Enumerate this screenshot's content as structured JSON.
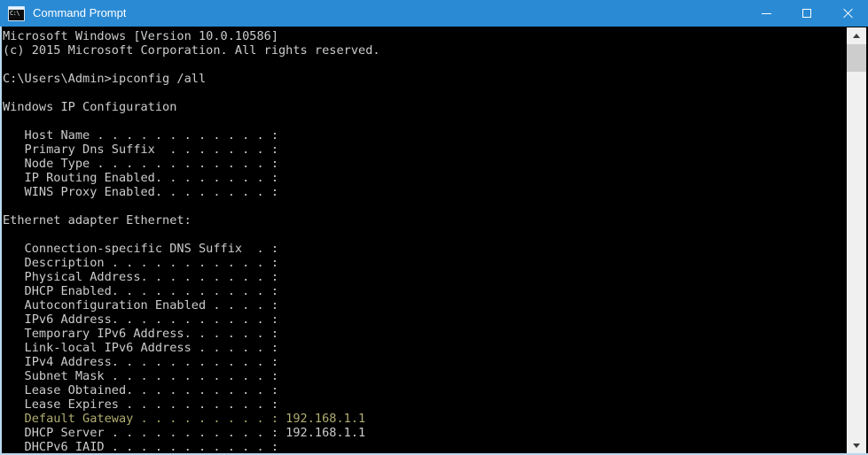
{
  "window": {
    "title": "Command Prompt",
    "icon": "command-prompt-icon",
    "icon_text": "C:\\",
    "titlebar_color": "#2a8ad4",
    "background_color": "#000000",
    "text_color": "#cccccc",
    "highlight_text_color": "#b0ad70"
  },
  "controls": {
    "minimize_label": "Minimize",
    "maximize_label": "Maximize",
    "close_label": "Close"
  },
  "scrollbar": {
    "up_arrow": "scroll-up-arrow",
    "down_arrow": "scroll-down-arrow",
    "thumb": "scrollbar-thumb"
  },
  "console": {
    "prompt_path": "C:\\Users\\Admin>",
    "command": "ipconfig /all",
    "lines": [
      {
        "text": "Microsoft Windows [Version 10.0.10586]",
        "color": "white"
      },
      {
        "text": "(c) 2015 Microsoft Corporation. All rights reserved.",
        "color": "white"
      },
      {
        "text": "",
        "color": "white"
      },
      {
        "text": "C:\\Users\\Admin>ipconfig /all",
        "color": "white"
      },
      {
        "text": "",
        "color": "white"
      },
      {
        "text": "Windows IP Configuration",
        "color": "white"
      },
      {
        "text": "",
        "color": "white"
      },
      {
        "text": "   Host Name . . . . . . . . . . . . :",
        "color": "white"
      },
      {
        "text": "   Primary Dns Suffix  . . . . . . . :",
        "color": "white"
      },
      {
        "text": "   Node Type . . . . . . . . . . . . :",
        "color": "white"
      },
      {
        "text": "   IP Routing Enabled. . . . . . . . :",
        "color": "white"
      },
      {
        "text": "   WINS Proxy Enabled. . . . . . . . :",
        "color": "white"
      },
      {
        "text": "",
        "color": "white"
      },
      {
        "text": "Ethernet adapter Ethernet:",
        "color": "white"
      },
      {
        "text": "",
        "color": "white"
      },
      {
        "text": "   Connection-specific DNS Suffix  . :",
        "color": "white"
      },
      {
        "text": "   Description . . . . . . . . . . . :",
        "color": "white"
      },
      {
        "text": "   Physical Address. . . . . . . . . :",
        "color": "white"
      },
      {
        "text": "   DHCP Enabled. . . . . . . . . . . :",
        "color": "white"
      },
      {
        "text": "   Autoconfiguration Enabled . . . . :",
        "color": "white"
      },
      {
        "text": "   IPv6 Address. . . . . . . . . . . :",
        "color": "white"
      },
      {
        "text": "   Temporary IPv6 Address. . . . . . :",
        "color": "white"
      },
      {
        "text": "   Link-local IPv6 Address . . . . . :",
        "color": "white"
      },
      {
        "text": "   IPv4 Address. . . . . . . . . . . :",
        "color": "white"
      },
      {
        "text": "   Subnet Mask . . . . . . . . . . . :",
        "color": "white"
      },
      {
        "text": "   Lease Obtained. . . . . . . . . . :",
        "color": "white"
      },
      {
        "text": "   Lease Expires . . . . . . . . . . :",
        "color": "white"
      },
      {
        "text": "   Default Gateway . . . . . . . . . : 192.168.1.1",
        "color": "olive"
      },
      {
        "text": "   DHCP Server . . . . . . . . . . . : 192.168.1.1",
        "color": "white"
      },
      {
        "text": "   DHCPv6 IAID . . . . . . . . . . . :",
        "color": "white"
      }
    ]
  }
}
